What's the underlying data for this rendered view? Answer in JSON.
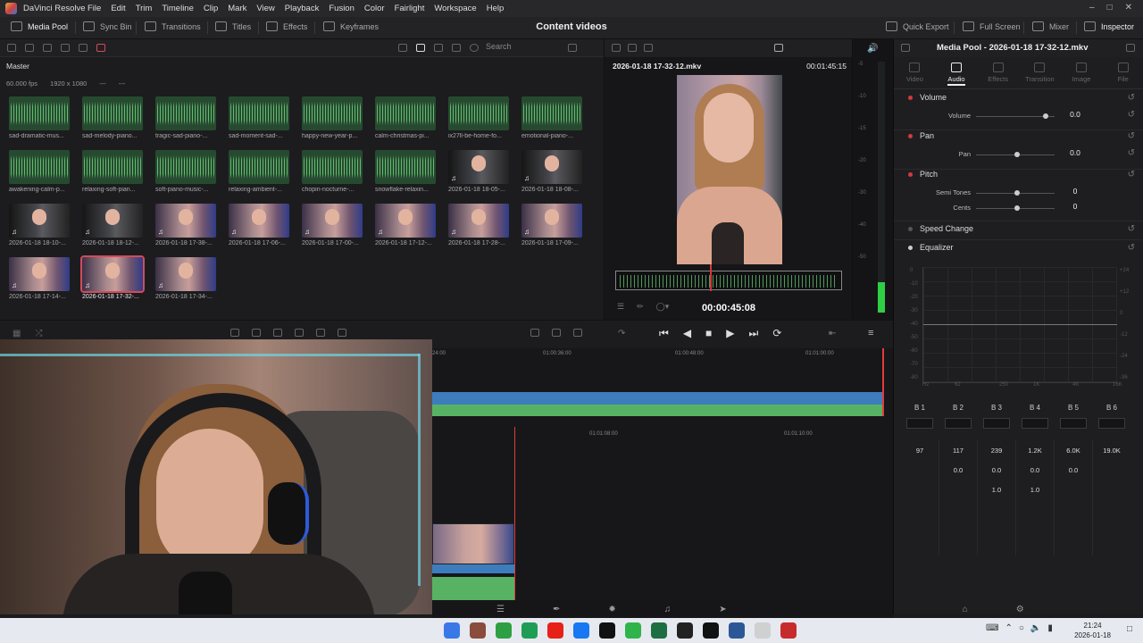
{
  "app": {
    "name": "DaVinci Resolve"
  },
  "menu": [
    "File",
    "Edit",
    "Trim",
    "Timeline",
    "Clip",
    "Mark",
    "View",
    "Playback",
    "Fusion",
    "Color",
    "Fairlight",
    "Workspace",
    "Help"
  ],
  "toolbar": {
    "media_pool": "Media Pool",
    "sync_bin": "Sync Bin",
    "transitions": "Transitions",
    "titles": "Titles",
    "effects": "Effects",
    "keyframes": "Keyframes",
    "page_title": "Content videos",
    "quick_export": "Quick Export",
    "full_screen": "Full Screen",
    "mixer": "Mixer",
    "inspector": "Inspector"
  },
  "media_pool": {
    "search_placeholder": "Search",
    "bin": "Master",
    "fps": "60.000 fps",
    "resolution": "1920 x 1080",
    "dash1": "---",
    "dash2": "---",
    "clips": [
      {
        "label": "sad-dramatic-mus...",
        "kind": "audio"
      },
      {
        "label": "sad-melody-piano...",
        "kind": "audio"
      },
      {
        "label": "tragic-sad-piano-...",
        "kind": "audio"
      },
      {
        "label": "sad-moment-sad-...",
        "kind": "audio"
      },
      {
        "label": "happy-new-year-p...",
        "kind": "audio"
      },
      {
        "label": "calm-christmas-pi...",
        "kind": "audio"
      },
      {
        "label": "ix27ll-be-home-fo...",
        "kind": "audio"
      },
      {
        "label": "emotional-piano-...",
        "kind": "audio"
      },
      {
        "label": "awakening-calm-p...",
        "kind": "audio"
      },
      {
        "label": "relaxing-soft-pian...",
        "kind": "audio"
      },
      {
        "label": "soft-piano-music-...",
        "kind": "audio"
      },
      {
        "label": "relaxing-ambient-...",
        "kind": "audio"
      },
      {
        "label": "chopin-nocturne-...",
        "kind": "audio"
      },
      {
        "label": "snowflake-relaxin...",
        "kind": "audio"
      },
      {
        "label": "2026-01-18 18-05-...",
        "kind": "dark"
      },
      {
        "label": "2026-01-18 18-08-...",
        "kind": "dark"
      },
      {
        "label": "2026-01-18 18-10-...",
        "kind": "dark"
      },
      {
        "label": "2026-01-18 18-12-...",
        "kind": "dark"
      },
      {
        "label": "2026-01-18 17-38-...",
        "kind": "video"
      },
      {
        "label": "2026-01-18 17-06-...",
        "kind": "video"
      },
      {
        "label": "2026-01-18 17-00-...",
        "kind": "video"
      },
      {
        "label": "2026-01-18 17-12-...",
        "kind": "video"
      },
      {
        "label": "2026-01-18 17-28-...",
        "kind": "video"
      },
      {
        "label": "2026-01-18 17-09-...",
        "kind": "video"
      },
      {
        "label": "2026-01-18 17-14-...",
        "kind": "video"
      },
      {
        "label": "2026-01-18 17-32-...",
        "kind": "video",
        "selected": true
      },
      {
        "label": "2026-01-18 17-34-...",
        "kind": "video"
      }
    ]
  },
  "viewer": {
    "filename": "2026-01-18 17-32-12.mkv",
    "duration": "00:01:45:15",
    "timecode": "00:00:45:08"
  },
  "meter_scale": [
    "-5",
    "-10",
    "-15",
    "-20",
    "-30",
    "-40",
    "-50"
  ],
  "inspector": {
    "title": "Media Pool - 2026-01-18 17-32-12.mkv",
    "tabs": [
      "Video",
      "Audio",
      "Effects",
      "Transition",
      "Image",
      "File"
    ],
    "volume": {
      "header": "Volume",
      "label": "Volume",
      "value": "0.0"
    },
    "pan": {
      "header": "Pan",
      "label": "Pan",
      "value": "0.0"
    },
    "pitch": {
      "header": "Pitch",
      "semitones_label": "Semi Tones",
      "semitones": "0",
      "cents_label": "Cents",
      "cents": "0"
    },
    "speed_change": "Speed Change",
    "equalizer": "Equalizer",
    "eq_db": [
      "0",
      "-10",
      "-20",
      "-30",
      "-40",
      "-50",
      "-60",
      "-70",
      "-80"
    ],
    "eq_db_right": [
      "+24",
      "+12",
      "0",
      "-12",
      "-24",
      "-36"
    ],
    "eq_freq": [
      "Hz",
      "62",
      "250",
      "1K",
      "4K",
      "16K"
    ],
    "bands": [
      {
        "name": "B 1",
        "freq": "97",
        "gain": "",
        "q": ""
      },
      {
        "name": "B 2",
        "freq": "117",
        "gain": "0.0",
        "q": ""
      },
      {
        "name": "B 3",
        "freq": "239",
        "gain": "0.0",
        "q": "1.0"
      },
      {
        "name": "B 4",
        "freq": "1.2K",
        "gain": "0.0",
        "q": "1.0"
      },
      {
        "name": "B 5",
        "freq": "6.0K",
        "gain": "0.0",
        "q": ""
      },
      {
        "name": "B 6",
        "freq": "19.0K",
        "gain": "",
        "q": ""
      }
    ]
  },
  "timeline": {
    "ruler_top": [
      "24:00",
      "01:00:36:00",
      "01:00:48:00",
      "01:01:00:00"
    ],
    "ruler_bottom": [
      "01:01:08:00",
      "01:01:10:00"
    ]
  },
  "taskbar": {
    "time": "21:24",
    "date": "2026-01-18",
    "apps": [
      "#3b78e7",
      "#8a4c3c",
      "#2ea043",
      "#1f9d55",
      "#e62117",
      "#1877f2",
      "#111111",
      "#2fb44a",
      "#1d6f42",
      "#222222",
      "#111111",
      "#2b5797",
      "#d0d0d0",
      "#c72c2c"
    ]
  }
}
